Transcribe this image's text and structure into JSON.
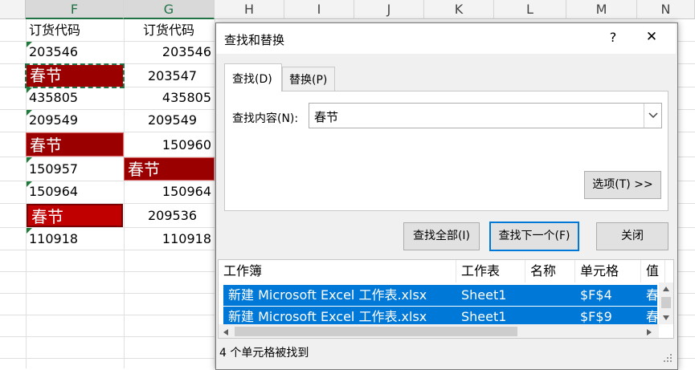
{
  "sheet": {
    "columns": [
      "F",
      "G",
      "H",
      "I",
      "J",
      "K",
      "L",
      "M",
      "N"
    ],
    "selected_columns": [
      "F",
      "G"
    ],
    "f_header": "订货代码",
    "g_header": "订货代码",
    "rows": [
      {
        "f": "203546",
        "g": "203546"
      },
      {
        "f": "春节",
        "g": "203547"
      },
      {
        "f": "435805",
        "g": "435805"
      },
      {
        "f": "209549",
        "g": "209549"
      },
      {
        "f": "春节",
        "g": "150960"
      },
      {
        "f": "150957",
        "g": "春节"
      },
      {
        "f": "150964",
        "g": "150964"
      },
      {
        "f": "春节",
        "g": "209536"
      },
      {
        "f": "110918",
        "g": "110918"
      }
    ],
    "highlight_color": "#9b0000",
    "highlight_color_alt": "#c00000"
  },
  "dialog": {
    "title": "查找和替换",
    "help_label": "?",
    "close_label": "✕",
    "tabs": [
      {
        "label": "查找(D)"
      },
      {
        "label": "替换(P)"
      }
    ],
    "find_label": "查找内容(N):",
    "find_value": "春节",
    "dropdown_icon": "chevron-down-icon",
    "options_button": "选项(T) >>",
    "find_all_button": "查找全部(I)",
    "find_next_button": "查找下一个(F)",
    "close_button": "关闭",
    "results": {
      "headers": [
        "工作簿",
        "工作表",
        "名称",
        "单元格",
        "值"
      ],
      "rows": [
        {
          "book": "新建 Microsoft Excel 工作表.xlsx",
          "sheet": "Sheet1",
          "name": "",
          "cell": "$F$4",
          "value": "春"
        },
        {
          "book": "新建 Microsoft Excel 工作表.xlsx",
          "sheet": "Sheet1",
          "name": "",
          "cell": "$F$9",
          "value": "春"
        }
      ]
    },
    "status": "4 个单元格被找到",
    "accent": "#0078d7"
  }
}
